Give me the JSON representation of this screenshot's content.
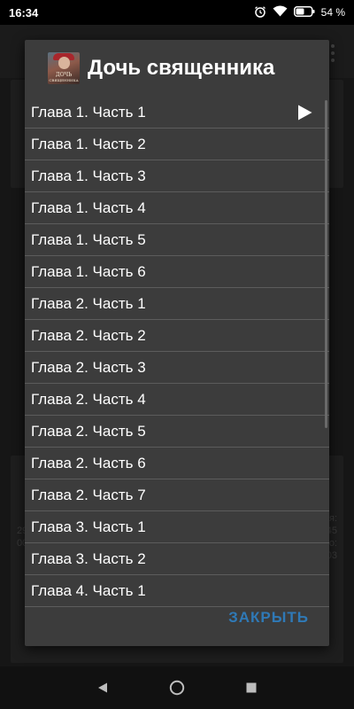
{
  "status_bar": {
    "time": "16:34",
    "battery_percent": "54 %",
    "icons": [
      "alarm-icon",
      "wifi-icon",
      "battery-icon"
    ]
  },
  "background": {
    "left_text": [
      "29",
      "00"
    ],
    "right_text": [
      "я:",
      "45",
      "о:",
      "03"
    ]
  },
  "dialog": {
    "title": "Дочь священника",
    "cover_lines": [
      "ДОЧЬ",
      "СВЯЩЕННИКА"
    ],
    "chapters": [
      {
        "label": "Глава 1. Часть 1",
        "playing": true
      },
      {
        "label": "Глава 1. Часть 2"
      },
      {
        "label": "Глава 1. Часть 3"
      },
      {
        "label": "Глава 1. Часть 4"
      },
      {
        "label": "Глава 1. Часть 5"
      },
      {
        "label": "Глава 1. Часть 6"
      },
      {
        "label": "Глава 2. Часть 1"
      },
      {
        "label": "Глава 2. Часть 2"
      },
      {
        "label": "Глава 2. Часть 3"
      },
      {
        "label": "Глава 2. Часть 4"
      },
      {
        "label": "Глава 2. Часть 5"
      },
      {
        "label": "Глава 2. Часть 6"
      },
      {
        "label": "Глава 2. Часть 7"
      },
      {
        "label": "Глава 3. Часть 1"
      },
      {
        "label": "Глава 3. Часть 2"
      },
      {
        "label": "Глава 4. Часть 1"
      }
    ],
    "close_label": "ЗАКРЫТЬ",
    "accent_color": "#2f79b6"
  },
  "nav_bar": {
    "buttons": [
      "back-icon",
      "home-icon",
      "recents-icon"
    ]
  }
}
